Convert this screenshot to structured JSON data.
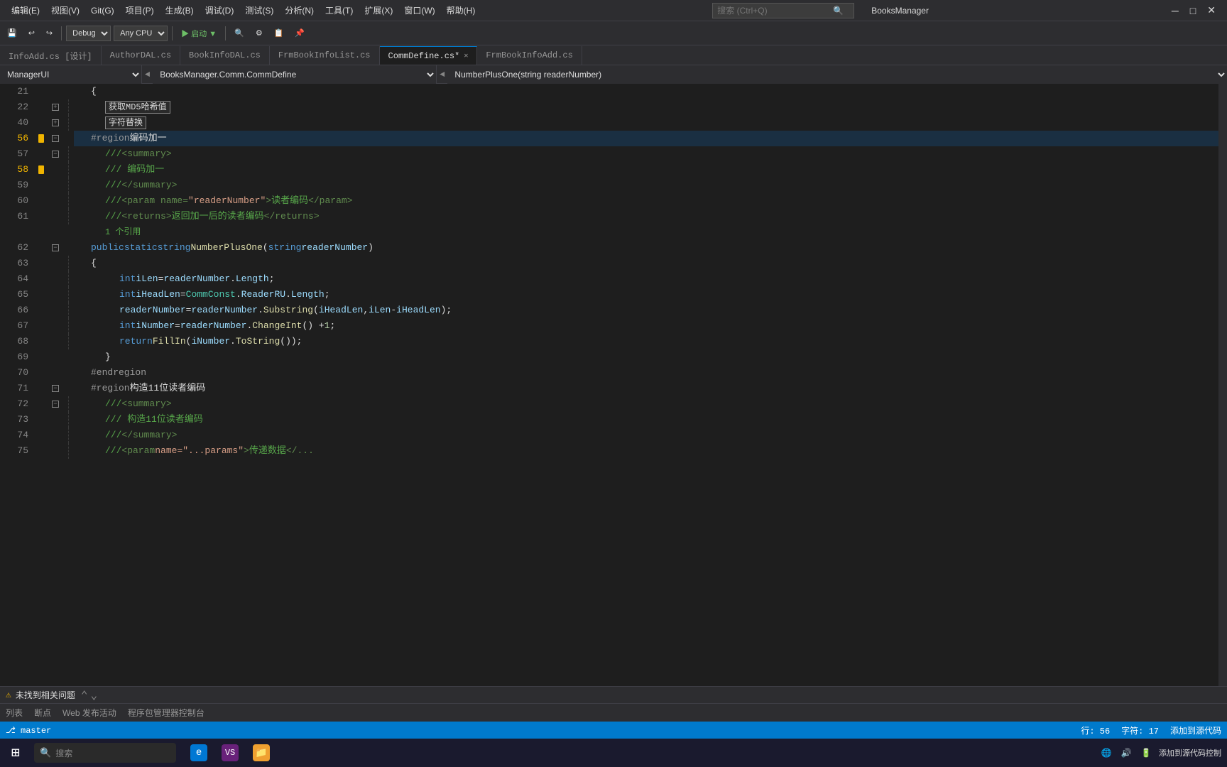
{
  "app": {
    "title": "BooksManager",
    "search_placeholder": "搜索 (Ctrl+Q)"
  },
  "menu": {
    "items": [
      "编辑(E)",
      "视图(V)",
      "Git(G)",
      "项目(P)",
      "生成(B)",
      "调试(D)",
      "测试(S)",
      "分析(N)",
      "工具(T)",
      "扩展(X)",
      "窗口(W)",
      "帮助(H)"
    ]
  },
  "toolbar": {
    "debug_mode": "Debug",
    "cpu": "Any CPU",
    "start": "▶ 启动 ▼"
  },
  "tabs": [
    {
      "label": "InfoAdd.cs [设计]",
      "active": false
    },
    {
      "label": "AuthorDAL.cs",
      "active": false
    },
    {
      "label": "BookInfoDAL.cs",
      "active": false
    },
    {
      "label": "FrmBookInfoList.cs",
      "active": false
    },
    {
      "label": "CommDefine.cs*",
      "active": true,
      "closeable": true
    },
    {
      "label": "FrmBookInfoAdd.cs",
      "active": false
    }
  ],
  "nav": {
    "namespace": "BooksManager.Comm.CommDefine",
    "method": "NumberPlusOne(string readerNumber)"
  },
  "lines": [
    {
      "num": 21,
      "indent": 1,
      "content": "{",
      "fold": null,
      "bookmark": false
    },
    {
      "num": 22,
      "indent": 2,
      "content": "获取MD5哈希值",
      "collapsed": true,
      "fold": "+",
      "bookmark": false
    },
    {
      "num": 40,
      "indent": 2,
      "content": "字符替换",
      "collapsed": true,
      "fold": "+",
      "bookmark": false
    },
    {
      "num": 56,
      "indent": 1,
      "content": "#region 编码加一",
      "region": true,
      "fold": "-",
      "bookmark": true
    },
    {
      "num": 57,
      "indent": 2,
      "content": "/// <summary>",
      "xmldoc": true,
      "fold": "-",
      "bookmark": false
    },
    {
      "num": 58,
      "indent": 2,
      "content": "/// 编码加一",
      "xmldoc": true,
      "fold": null,
      "bookmark": true
    },
    {
      "num": 59,
      "indent": 2,
      "content": "/// </summary>",
      "xmldoc": true,
      "fold": null,
      "bookmark": false
    },
    {
      "num": 60,
      "indent": 2,
      "content": "/// <param name=\"readerNumber\">读者编码</param>",
      "xmldoc": true,
      "fold": null,
      "bookmark": false
    },
    {
      "num": 61,
      "indent": 2,
      "content": "/// <returns>返回加一后的读者编码</returns>",
      "xmldoc": true,
      "fold": null,
      "bookmark": false
    },
    {
      "num": "",
      "indent": 2,
      "content": "1 个引用",
      "refcount": true,
      "fold": null,
      "bookmark": false
    },
    {
      "num": 62,
      "indent": 1,
      "content": "public static string NumberPlusOne(string readerNumber)",
      "method": true,
      "fold": "-",
      "bookmark": false
    },
    {
      "num": 63,
      "indent": 1,
      "content": "{",
      "fold": null,
      "bookmark": false
    },
    {
      "num": 64,
      "indent": 2,
      "content": "int iLen = readerNumber.Length;",
      "code": true,
      "fold": null,
      "bookmark": false
    },
    {
      "num": 65,
      "indent": 2,
      "content": "int iHeadLen = CommConst.ReaderRU.Length;",
      "code": true,
      "fold": null,
      "bookmark": false
    },
    {
      "num": 66,
      "indent": 2,
      "content": "readerNumber = readerNumber.Substring(iHeadLen, iLen - iHeadLen);",
      "code": true,
      "fold": null,
      "bookmark": false
    },
    {
      "num": 67,
      "indent": 2,
      "content": "int iNumber = readerNumber.ChangeInt() + 1;",
      "code": true,
      "fold": null,
      "bookmark": false
    },
    {
      "num": 68,
      "indent": 2,
      "content": "return FillIn(iNumber.ToString());",
      "code": true,
      "fold": null,
      "bookmark": false
    },
    {
      "num": 69,
      "indent": 1,
      "content": "}",
      "fold": null,
      "bookmark": false
    },
    {
      "num": 70,
      "indent": 1,
      "content": "#endregion",
      "region": true,
      "fold": null,
      "bookmark": false
    },
    {
      "num": 71,
      "indent": 1,
      "content": "#region 构造11位读者编码",
      "region": true,
      "fold": "-",
      "bookmark": false
    },
    {
      "num": 72,
      "indent": 2,
      "content": "/// <summary>",
      "xmldoc": true,
      "fold": "-",
      "bookmark": false
    },
    {
      "num": 73,
      "indent": 2,
      "content": "/// 构造11位读者编码",
      "xmldoc": true,
      "fold": null,
      "bookmark": false
    },
    {
      "num": 74,
      "indent": 2,
      "content": "/// </summary>",
      "xmldoc": true,
      "fold": null,
      "bookmark": false
    },
    {
      "num": 75,
      "indent": 2,
      "content": "/// <param name=\"...\" >传递数据</...",
      "xmldoc": true,
      "fold": null,
      "bookmark": false
    }
  ],
  "status": {
    "warning": "未找到相关问题",
    "line": "行: 56",
    "char": "字符: 17",
    "add_source": "添加到源代码"
  },
  "bottom_tabs": [
    "列表",
    "断点",
    "Web 发布活动",
    "程序包管理器控制台"
  ],
  "taskbar": {
    "start_button": "⊞",
    "time": "添加到源代码控制"
  }
}
